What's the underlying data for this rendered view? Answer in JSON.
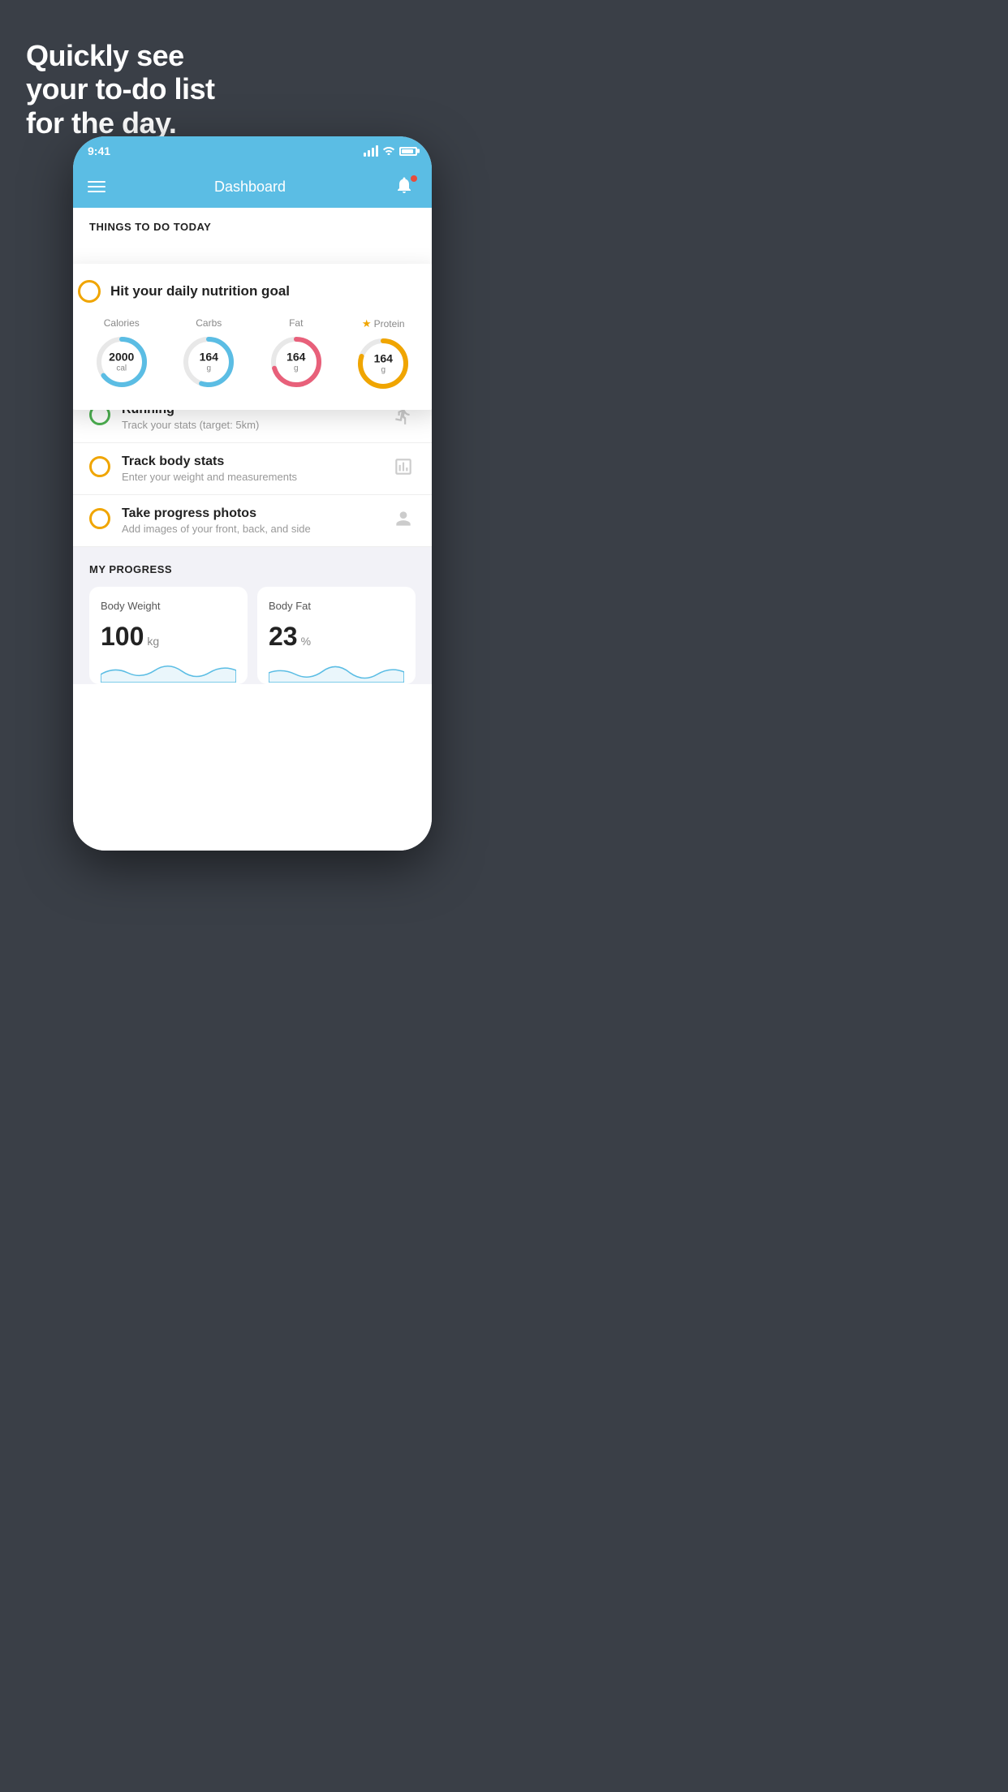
{
  "hero": {
    "line1": "Quickly see",
    "line2": "your to-do list",
    "line3": "for the day."
  },
  "status_bar": {
    "time": "9:41"
  },
  "nav": {
    "title": "Dashboard"
  },
  "things_header": "THINGS TO DO TODAY",
  "nutrition_card": {
    "circle_color": "#f0a500",
    "title": "Hit your daily nutrition goal",
    "items": [
      {
        "label": "Calories",
        "value": "2000",
        "unit": "cal",
        "color": "#5bbde4",
        "pct": 65
      },
      {
        "label": "Carbs",
        "value": "164",
        "unit": "g",
        "color": "#5bbde4",
        "pct": 55
      },
      {
        "label": "Fat",
        "value": "164",
        "unit": "g",
        "color": "#e8607a",
        "pct": 70
      },
      {
        "label": "Protein",
        "value": "164",
        "unit": "g",
        "color": "#f0a500",
        "pct": 80,
        "star": true
      }
    ]
  },
  "todo_items": [
    {
      "type": "green",
      "title": "Running",
      "subtitle": "Track your stats (target: 5km)",
      "icon": "shoe"
    },
    {
      "type": "yellow",
      "title": "Track body stats",
      "subtitle": "Enter your weight and measurements",
      "icon": "scale"
    },
    {
      "type": "yellow",
      "title": "Take progress photos",
      "subtitle": "Add images of your front, back, and side",
      "icon": "person"
    }
  ],
  "progress": {
    "header": "MY PROGRESS",
    "cards": [
      {
        "title": "Body Weight",
        "value": "100",
        "unit": "kg"
      },
      {
        "title": "Body Fat",
        "value": "23",
        "unit": "%"
      }
    ]
  }
}
